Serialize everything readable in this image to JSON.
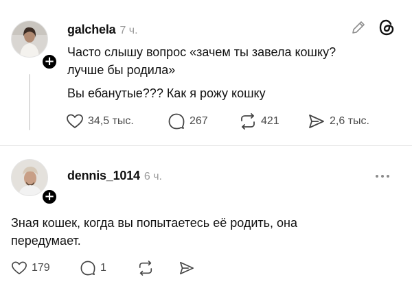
{
  "post": {
    "username": "galchela",
    "time": "7 ч.",
    "text_line1": "Часто слышу вопрос «зачем ты завела кошку?",
    "text_line2": "лучше бы родила»",
    "text_line3": "Вы ебанутые??? Как я рожу кошку",
    "likes": "34,5 тыс.",
    "replies": "267",
    "reposts": "421",
    "shares": "2,6 тыс.",
    "follow_glyph": "+"
  },
  "reply": {
    "username": "dennis_1014",
    "time": "6 ч.",
    "text_line1": "Зная кошек, когда вы попытаетесь её родить, она",
    "text_line2": "передумает.",
    "likes": "179",
    "replies": "1",
    "follow_glyph": "+"
  },
  "icons": {
    "edit": "pencil-icon",
    "app": "threads-logo-icon",
    "more": "more-dots-icon",
    "like": "heart-icon",
    "reply": "comment-bubble-icon",
    "repost": "repost-icon",
    "share": "send-icon"
  }
}
